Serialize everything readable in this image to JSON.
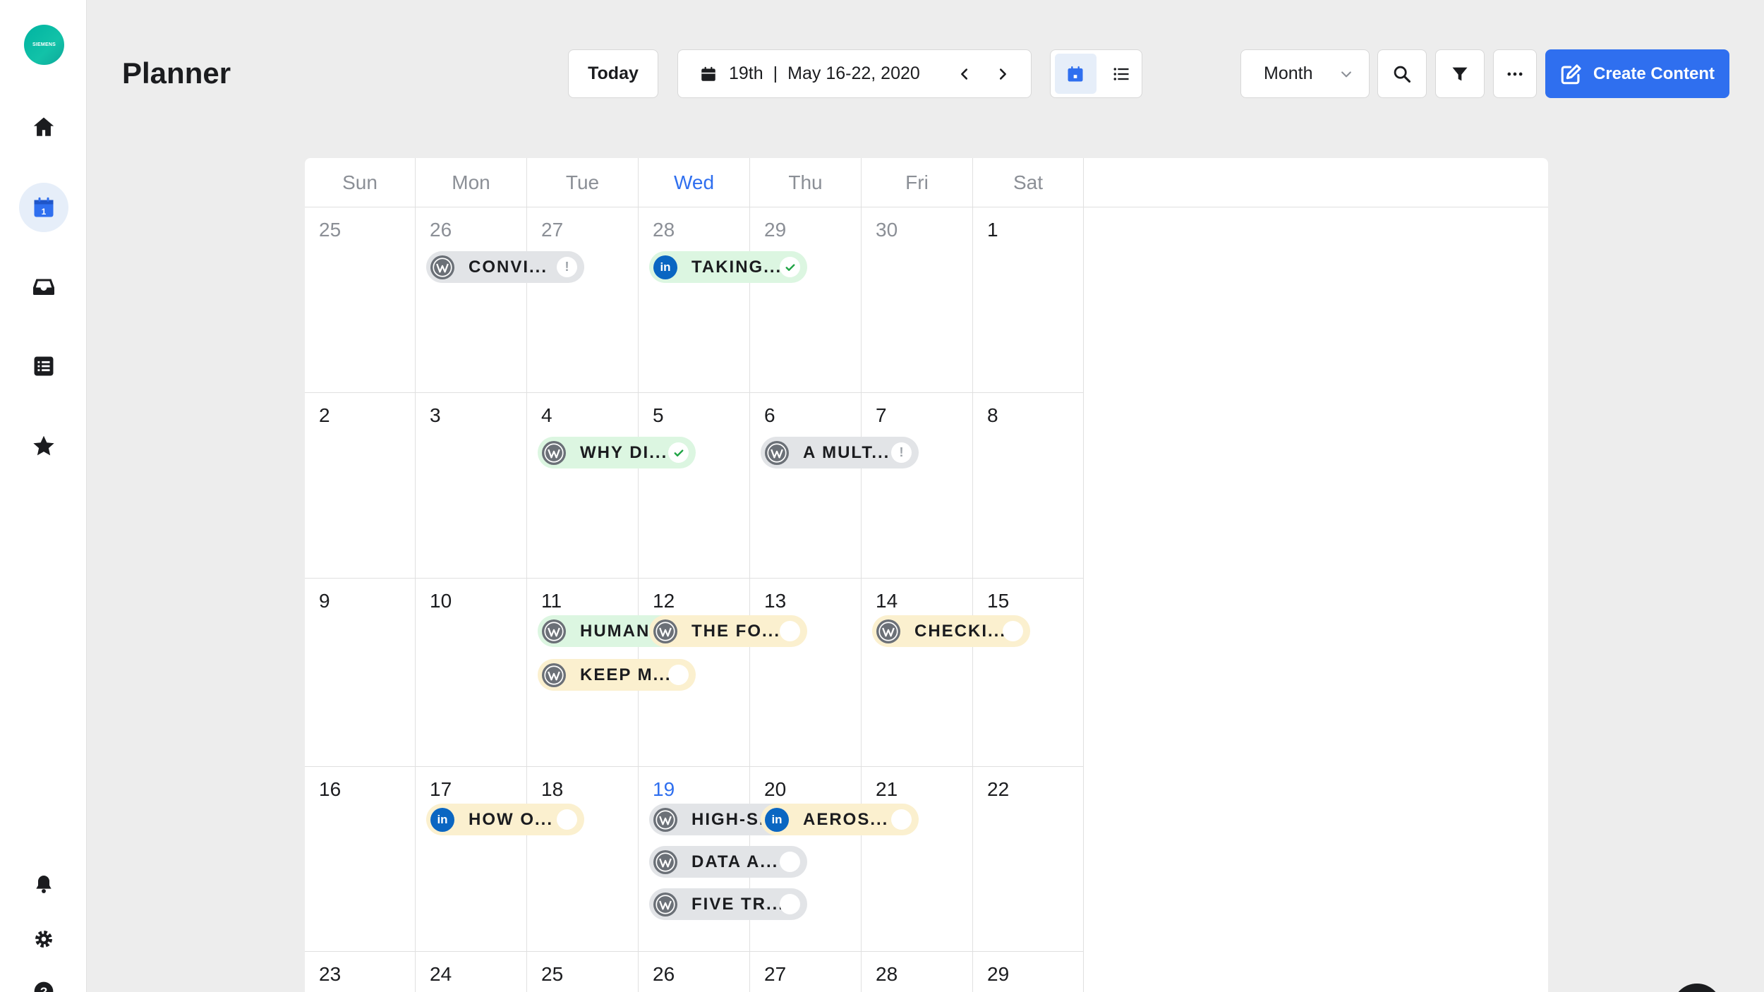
{
  "sidebar": {
    "logo_text": "SIEMENS",
    "items": [
      {
        "name": "home-icon",
        "active": false
      },
      {
        "name": "calendar-icon",
        "active": true
      },
      {
        "name": "inbox-icon",
        "active": false
      },
      {
        "name": "list-icon",
        "active": false
      },
      {
        "name": "star-icon",
        "active": false
      },
      {
        "name": "bell-icon",
        "active": false
      },
      {
        "name": "gear-icon",
        "active": false
      },
      {
        "name": "help-icon",
        "active": false
      }
    ]
  },
  "header": {
    "title": "Planner",
    "today_label": "Today",
    "date_day": "19th",
    "date_range": "May 16-22, 2020",
    "view_select": "Month",
    "create_label": "Create Content"
  },
  "colors": {
    "accent": "#2f6fef",
    "green_pill": "#dcf6e1",
    "yellow_pill": "#fbf0cf",
    "gray_pill": "#e2e4e7",
    "wordpress": "#6b7077",
    "linkedin": "#0a66c2"
  },
  "calendar": {
    "weekdays": [
      "Sun",
      "Mon",
      "Tue",
      "Wed",
      "Thu",
      "Fri",
      "Sat"
    ],
    "today_weekday": "Wed",
    "weeks": [
      [
        {
          "d": "25",
          "muted": true,
          "posts": []
        },
        {
          "d": "26",
          "muted": true,
          "posts": [
            {
              "icon": "wordpress-icon",
              "title": "CONVI...",
              "tone": "gray",
              "status": "alert"
            }
          ]
        },
        {
          "d": "27",
          "muted": true,
          "posts": []
        },
        {
          "d": "28",
          "muted": true,
          "posts": [
            {
              "icon": "linkedin-icon",
              "title": "TAKING...",
              "tone": "green",
              "status": "check"
            }
          ]
        },
        {
          "d": "29",
          "muted": true,
          "posts": []
        },
        {
          "d": "30",
          "muted": true,
          "posts": []
        },
        {
          "d": "1",
          "posts": []
        }
      ],
      [
        {
          "d": "2",
          "posts": []
        },
        {
          "d": "3",
          "posts": []
        },
        {
          "d": "4",
          "posts": [
            {
              "icon": "wordpress-icon",
              "title": "WHY DI...",
              "tone": "green",
              "status": "check"
            }
          ]
        },
        {
          "d": "5",
          "posts": []
        },
        {
          "d": "6",
          "posts": [
            {
              "icon": "wordpress-icon",
              "title": "A MULT...",
              "tone": "gray",
              "status": "alert"
            }
          ]
        },
        {
          "d": "7",
          "posts": []
        },
        {
          "d": "8",
          "posts": []
        }
      ],
      [
        {
          "d": "9",
          "posts": []
        },
        {
          "d": "10",
          "posts": []
        },
        {
          "d": "11",
          "posts": [
            {
              "icon": "wordpress-icon",
              "title": "HUMAN...",
              "tone": "green",
              "status": "check"
            },
            {
              "icon": "wordpress-icon",
              "title": "KEEP M...",
              "tone": "yellow",
              "status": "empty"
            }
          ]
        },
        {
          "d": "12",
          "posts": [
            {
              "icon": "wordpress-icon",
              "title": "THE FO...",
              "tone": "yellow",
              "status": "empty"
            }
          ]
        },
        {
          "d": "13",
          "posts": []
        },
        {
          "d": "14",
          "posts": [
            {
              "icon": "wordpress-icon",
              "title": "CHECKI...",
              "tone": "yellow",
              "status": "empty"
            }
          ]
        },
        {
          "d": "15",
          "posts": []
        }
      ],
      [
        {
          "d": "16",
          "posts": []
        },
        {
          "d": "17",
          "posts": [
            {
              "icon": "linkedin-icon",
              "title": "HOW O...",
              "tone": "yellow",
              "status": "empty"
            }
          ]
        },
        {
          "d": "18",
          "posts": []
        },
        {
          "d": "19",
          "today": true,
          "posts": [
            {
              "icon": "wordpress-icon",
              "title": "HIGH-S...",
              "tone": "gray",
              "status": "empty"
            },
            {
              "icon": "wordpress-icon",
              "title": "DATA A...",
              "tone": "gray",
              "status": "empty"
            },
            {
              "icon": "wordpress-icon",
              "title": "FIVE TR...",
              "tone": "gray",
              "status": "empty"
            }
          ]
        },
        {
          "d": "20",
          "posts": [
            {
              "icon": "linkedin-icon",
              "title": "AEROS...",
              "tone": "yellow",
              "status": "empty"
            }
          ]
        },
        {
          "d": "21",
          "posts": []
        },
        {
          "d": "22",
          "posts": []
        }
      ],
      [
        {
          "d": "23",
          "posts": []
        },
        {
          "d": "24",
          "posts": []
        },
        {
          "d": "25",
          "posts": []
        },
        {
          "d": "26",
          "posts": []
        },
        {
          "d": "27",
          "posts": []
        },
        {
          "d": "28",
          "posts": []
        },
        {
          "d": "29",
          "posts": []
        }
      ]
    ]
  }
}
